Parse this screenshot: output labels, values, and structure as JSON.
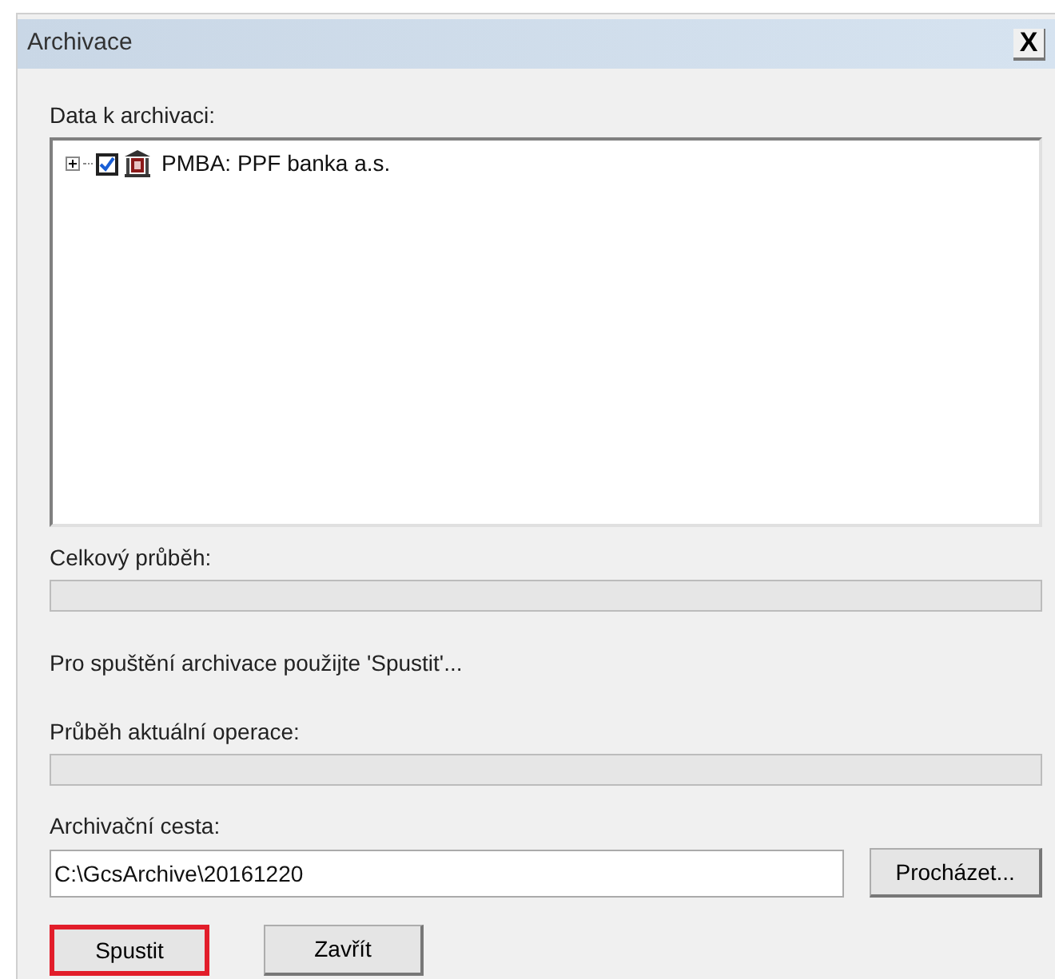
{
  "window": {
    "title": "Archivace",
    "close": "X"
  },
  "data_label": "Data k archivaci:",
  "tree": [
    {
      "label": "PMBA: PPF banka a.s.",
      "expanded": false,
      "checked": true
    }
  ],
  "overall_progress": {
    "label": "Celkový průběh:",
    "level": 0
  },
  "message": "Pro spuštění archivace použijte 'Spustit'...",
  "operation_progress": {
    "label": "Průběh aktuální operace:",
    "level": 0
  },
  "path": {
    "label": "Archivační cesta:",
    "value": "C:\\GcsArchive\\20161220",
    "browse": "Procházet..."
  },
  "buttons": [
    {
      "label": "Spustit",
      "highlighted": true
    },
    {
      "label": "Zavřít",
      "highlighted": false
    }
  ]
}
